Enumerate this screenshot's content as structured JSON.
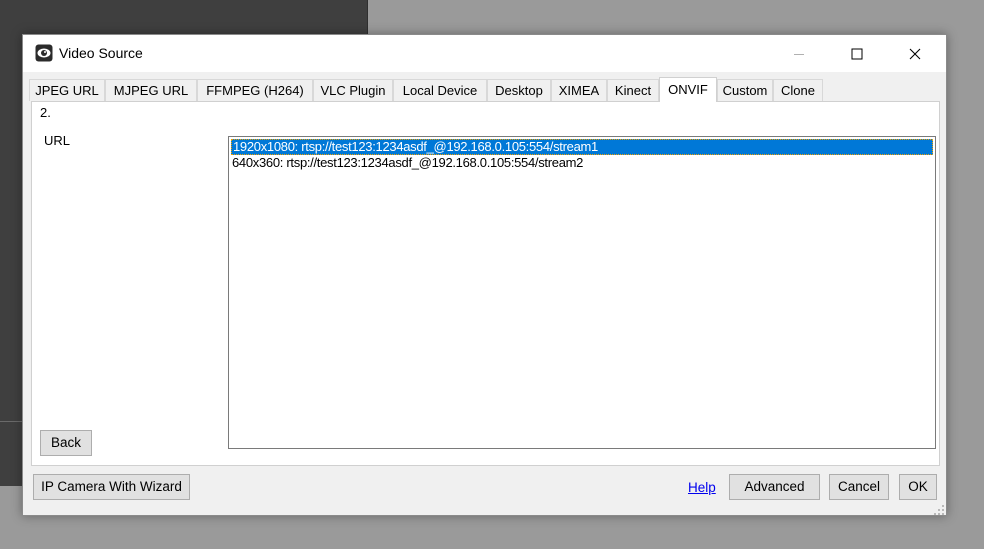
{
  "window": {
    "title": "Video Source",
    "icon": "eye-camera-icon"
  },
  "tabs": [
    {
      "label": "JPEG URL"
    },
    {
      "label": "MJPEG URL"
    },
    {
      "label": "FFMPEG (H264)"
    },
    {
      "label": "VLC Plugin"
    },
    {
      "label": "Local Device"
    },
    {
      "label": "Desktop"
    },
    {
      "label": "XIMEA"
    },
    {
      "label": "Kinect"
    },
    {
      "label": "ONVIF",
      "active": true
    },
    {
      "label": "Custom"
    },
    {
      "label": "Clone"
    }
  ],
  "panel": {
    "step": "2.",
    "url_label": "URL",
    "streams": [
      {
        "text": "1920x1080: rtsp://test123:1234asdf_@192.168.0.105:554/stream1",
        "selected": true
      },
      {
        "text": "640x360: rtsp://test123:1234asdf_@192.168.0.105:554/stream2",
        "selected": false
      }
    ],
    "back_label": "Back"
  },
  "footer": {
    "ip_camera_label": "IP Camera With Wizard",
    "help_label": "Help",
    "advanced_label": "Advanced",
    "cancel_label": "Cancel",
    "ok_label": "OK"
  },
  "colors": {
    "selection": "#0078d7",
    "link": "#0000ee",
    "window_bg": "#f0f0f0"
  }
}
